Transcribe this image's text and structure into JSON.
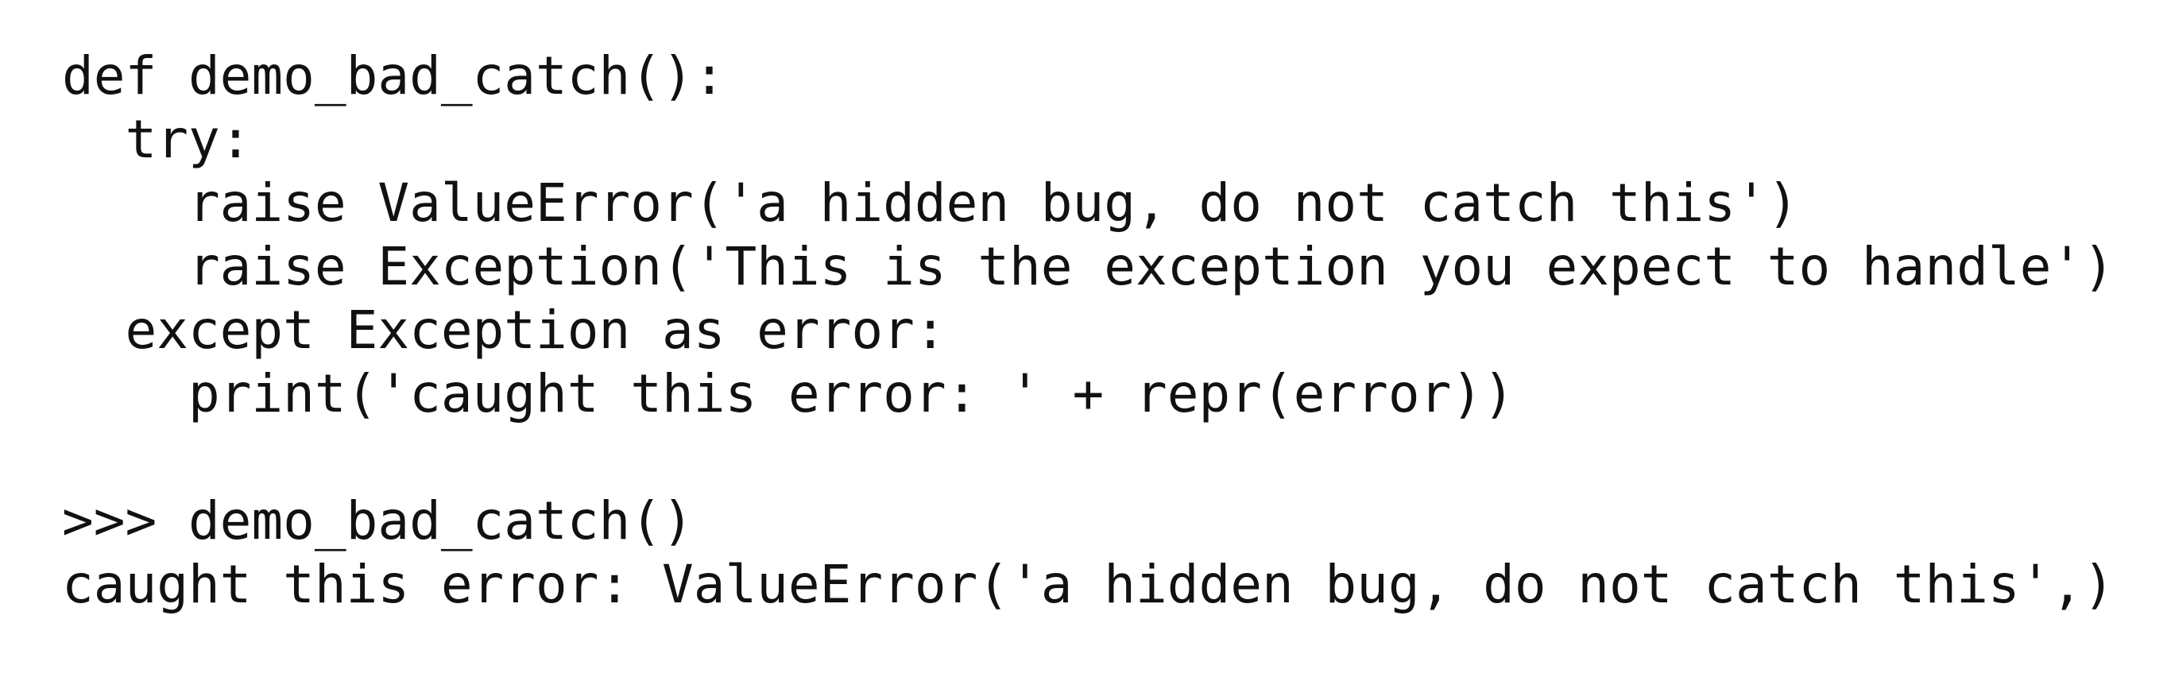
{
  "code": {
    "lines": [
      "def demo_bad_catch():",
      "  try:",
      "    raise ValueError('a hidden bug, do not catch this')",
      "    raise Exception('This is the exception you expect to handle')",
      "  except Exception as error:",
      "    print('caught this error: ' + repr(error))",
      "",
      ">>> demo_bad_catch()",
      "caught this error: ValueError('a hidden bug, do not catch this',)"
    ]
  }
}
